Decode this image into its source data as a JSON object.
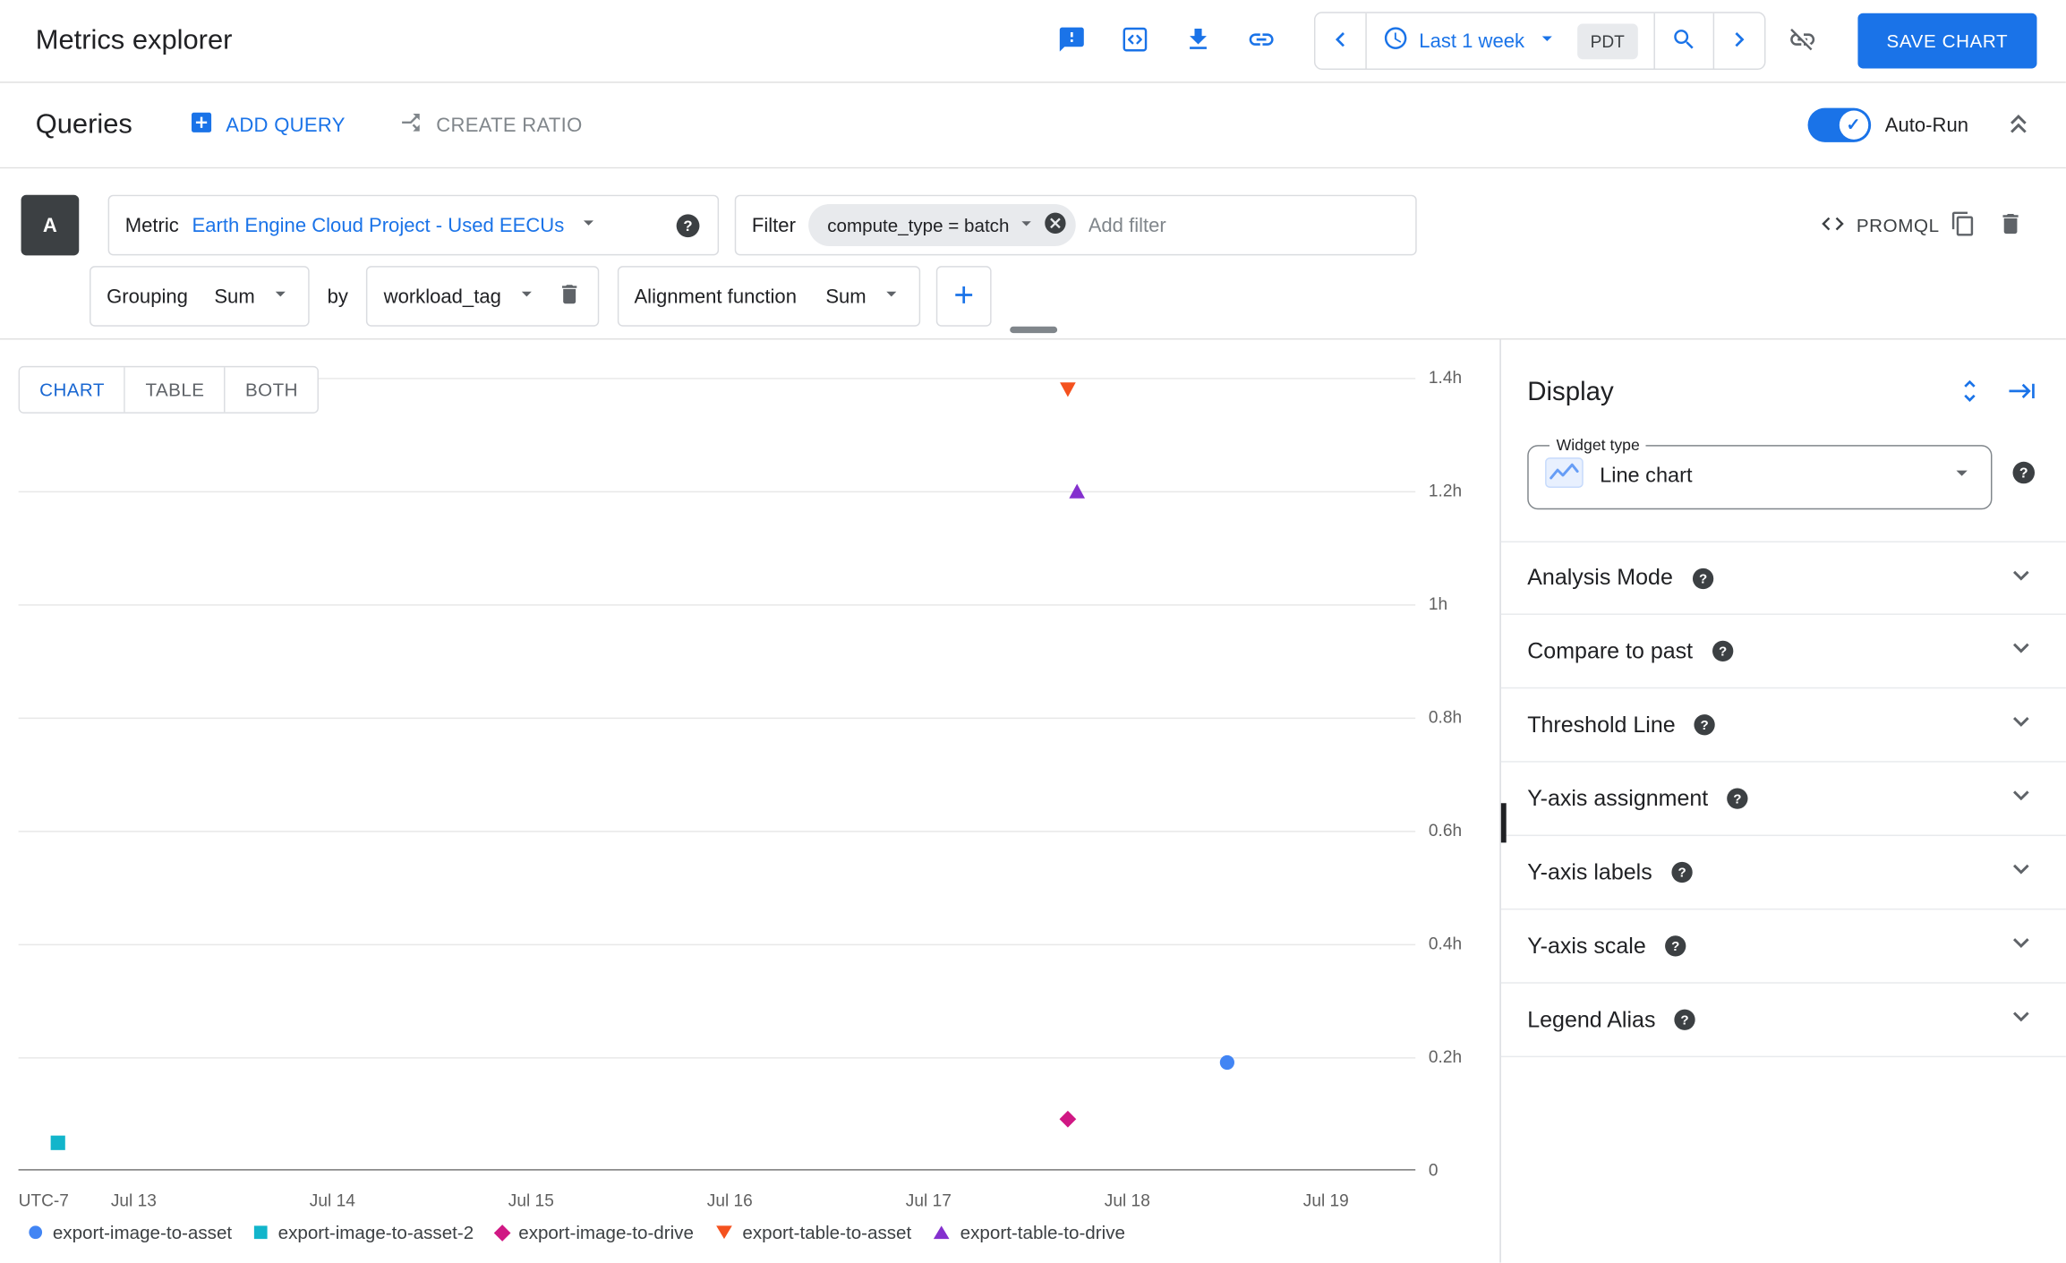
{
  "colors": {
    "accent_blue": "#1a73e8",
    "link_blue": "#1967d2"
  },
  "header": {
    "title": "Metrics explorer",
    "time_range_label": "Last 1 week",
    "timezone_badge": "PDT",
    "save_button_label": "SAVE CHART"
  },
  "queries_bar": {
    "title": "Queries",
    "add_query_label": "ADD QUERY",
    "create_ratio_label": "CREATE RATIO",
    "auto_run_label": "Auto-Run"
  },
  "query_builder": {
    "query_letter": "A",
    "metric_label": "Metric",
    "metric_value": "Earth Engine Cloud Project - Used EECUs",
    "filter_label": "Filter",
    "filter_chip_value": "compute_type = batch",
    "add_filter_placeholder": "Add filter",
    "promql_label": "PROMQL",
    "grouping_label": "Grouping",
    "grouping_value": "Sum",
    "by_label": "by",
    "group_by_value": "workload_tag",
    "alignment_label": "Alignment function",
    "alignment_value": "Sum"
  },
  "view_tabs": {
    "chart": "CHART",
    "table": "TABLE",
    "both": "BOTH",
    "active": "CHART"
  },
  "chart_data": {
    "type": "scatter",
    "unit": "hours",
    "grid": true,
    "legend_position": "bottom",
    "x_axis": {
      "timezone_label": "UTC-7",
      "domain_days_july": [
        12.42,
        19.45
      ],
      "ticks": [
        {
          "day": 13,
          "label": "Jul 13"
        },
        {
          "day": 14,
          "label": "Jul 14"
        },
        {
          "day": 15,
          "label": "Jul 15"
        },
        {
          "day": 16,
          "label": "Jul 16"
        },
        {
          "day": 17,
          "label": "Jul 17"
        },
        {
          "day": 18,
          "label": "Jul 18"
        },
        {
          "day": 19,
          "label": "Jul 19"
        }
      ]
    },
    "y_axis": {
      "max": 1.4,
      "ticks": [
        {
          "value": 0,
          "label": "0"
        },
        {
          "value": 0.2,
          "label": "0.2h"
        },
        {
          "value": 0.4,
          "label": "0.4h"
        },
        {
          "value": 0.6,
          "label": "0.6h"
        },
        {
          "value": 0.8,
          "label": "0.8h"
        },
        {
          "value": 1,
          "label": "1h"
        },
        {
          "value": 1.2,
          "label": "1.2h"
        },
        {
          "value": 1.4,
          "label": "1.4h"
        }
      ]
    },
    "series": [
      {
        "name": "export-image-to-asset",
        "marker": "circle",
        "color": "#4285F4",
        "points": [
          {
            "x_day_july": 18.5,
            "value_hours": 0.19
          }
        ]
      },
      {
        "name": "export-image-to-asset-2",
        "marker": "square",
        "color": "#12B5CB",
        "points": [
          {
            "x_day_july": 12.62,
            "value_hours": 0.05
          }
        ]
      },
      {
        "name": "export-image-to-drive",
        "marker": "diamond",
        "color": "#D01884",
        "points": [
          {
            "x_day_july": 17.7,
            "value_hours": 0.09
          }
        ]
      },
      {
        "name": "export-table-to-asset",
        "marker": "triangle-down",
        "color": "#F4511E",
        "points": [
          {
            "x_day_july": 17.7,
            "value_hours": 1.38
          }
        ]
      },
      {
        "name": "export-table-to-drive",
        "marker": "triangle-up",
        "color": "#8430CE",
        "points": [
          {
            "x_day_july": 17.75,
            "value_hours": 1.2
          }
        ]
      }
    ]
  },
  "display_panel": {
    "title": "Display",
    "widget_type_label": "Widget type",
    "widget_type_value": "Line chart",
    "sections": [
      {
        "label": "Analysis Mode"
      },
      {
        "label": "Compare to past"
      },
      {
        "label": "Threshold Line"
      },
      {
        "label": "Y-axis assignment"
      },
      {
        "label": "Y-axis labels"
      },
      {
        "label": "Y-axis scale"
      },
      {
        "label": "Legend Alias"
      }
    ]
  }
}
